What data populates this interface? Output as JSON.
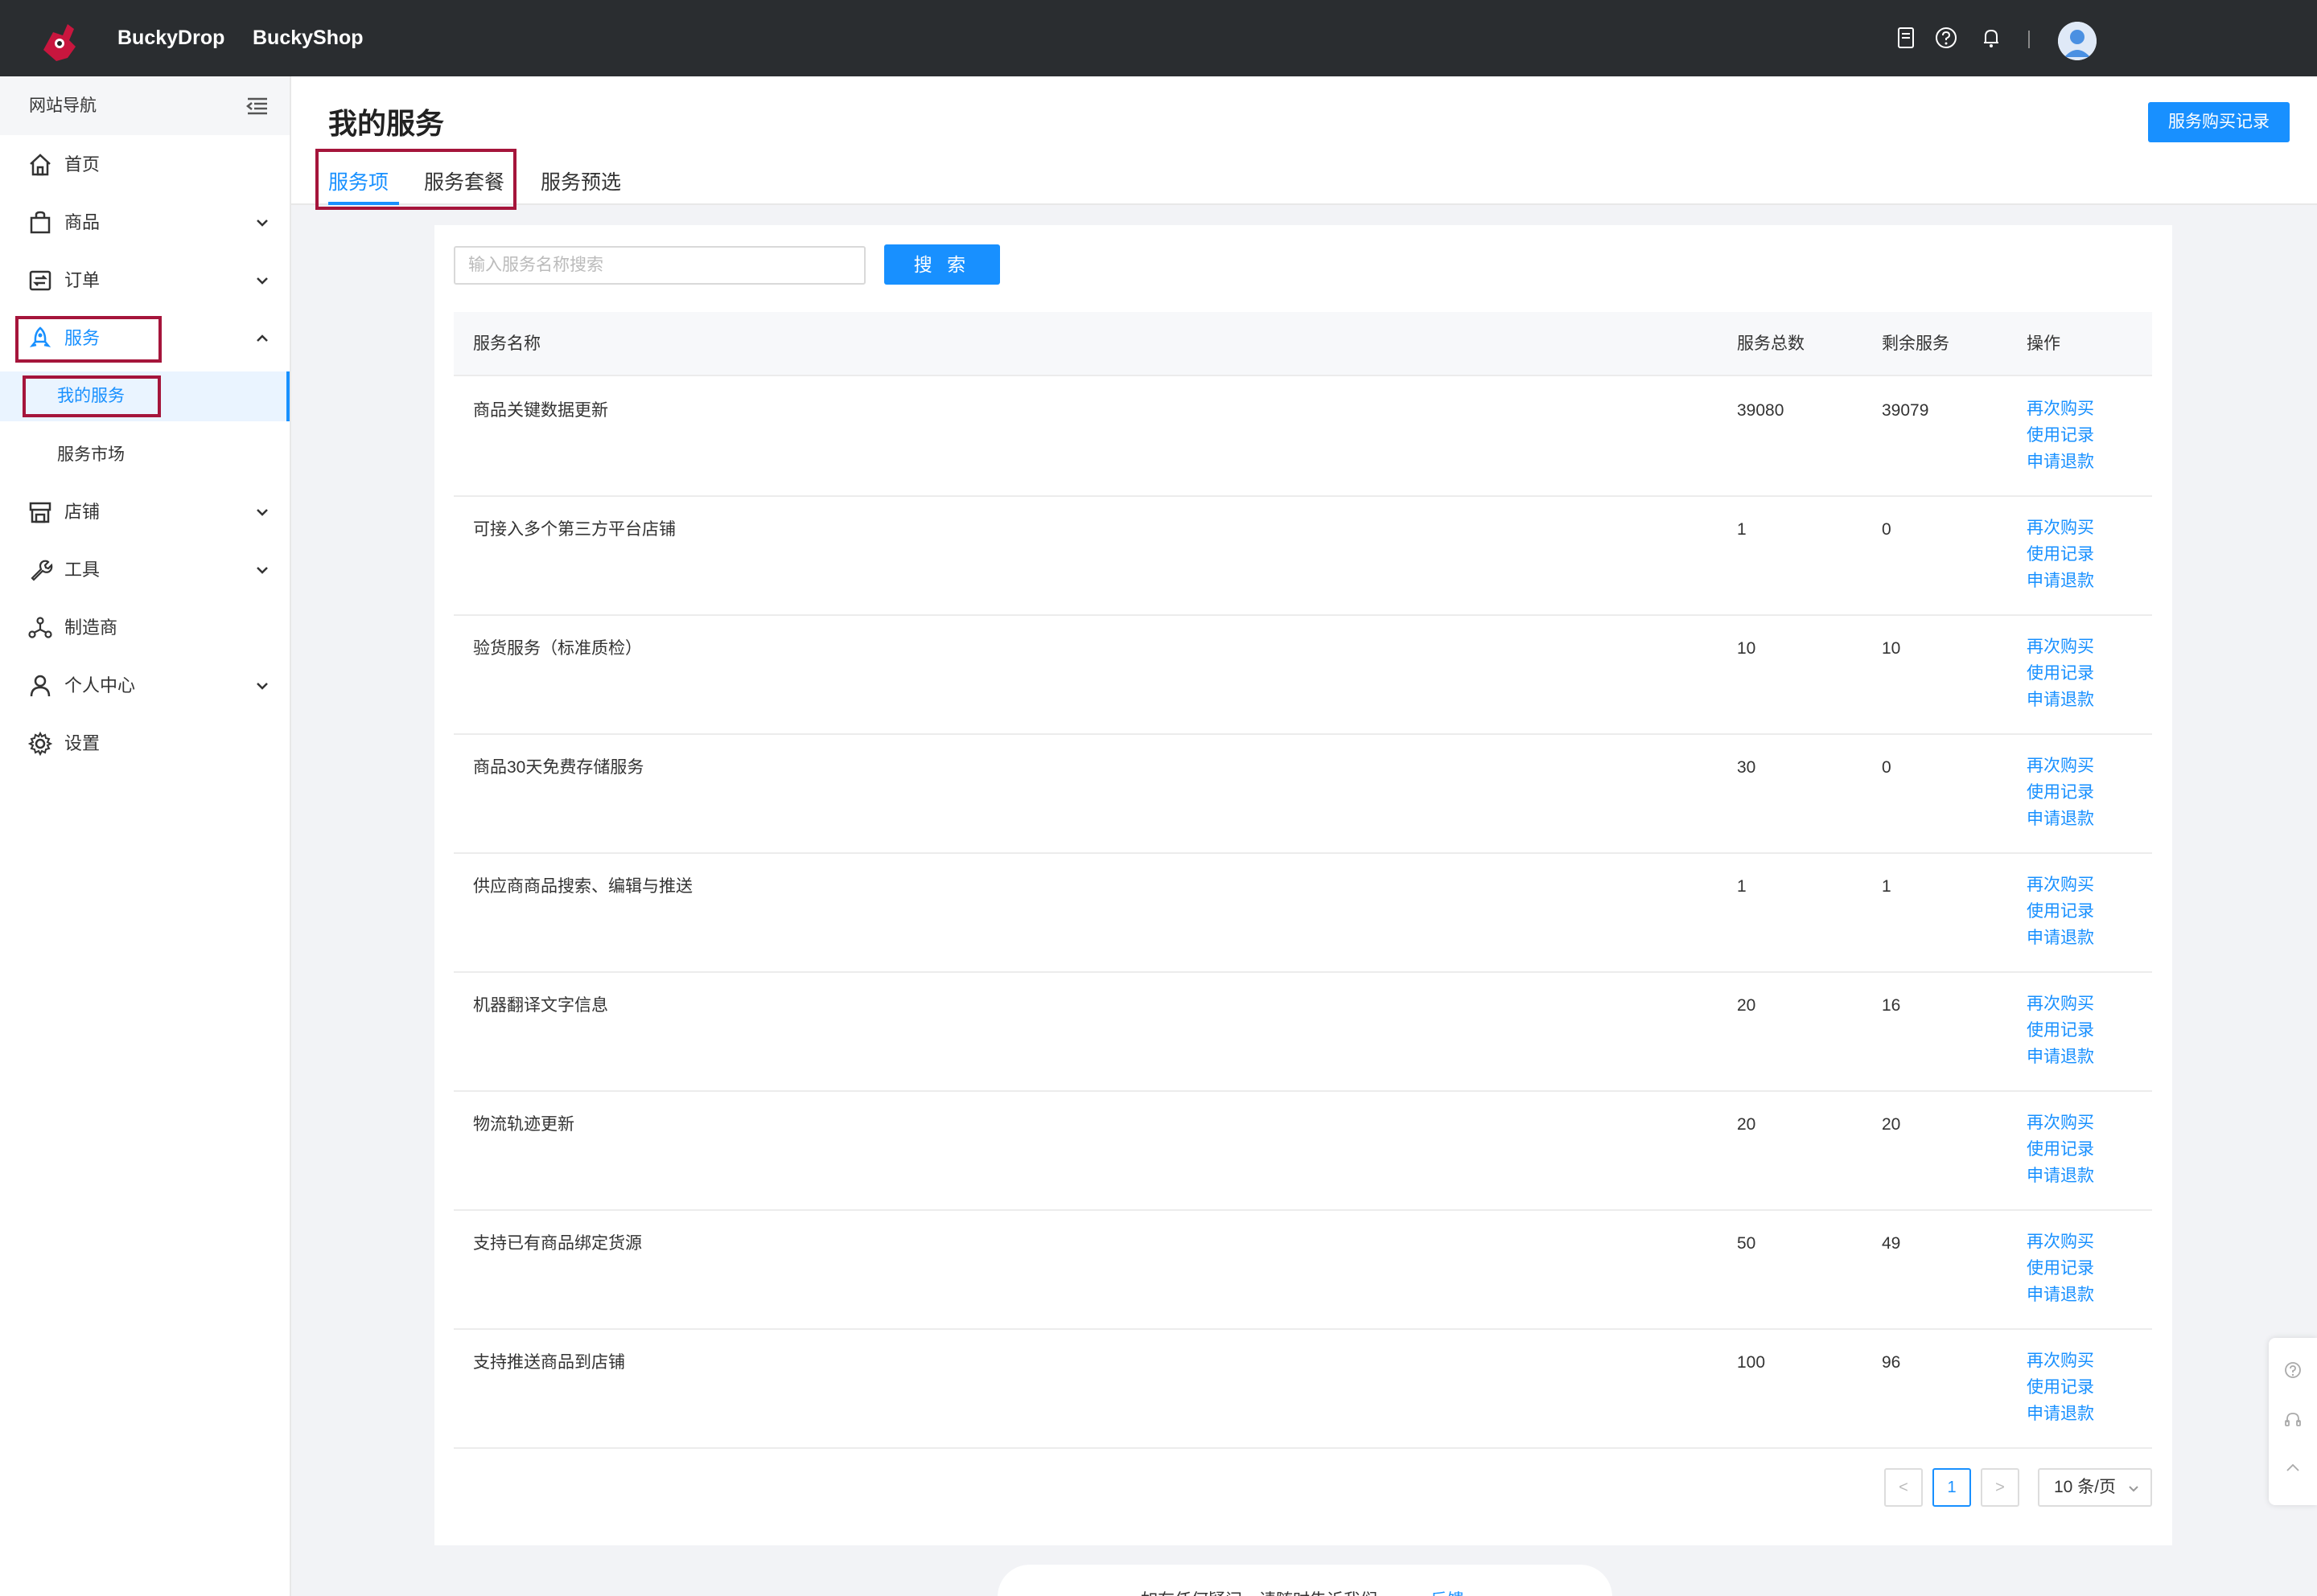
{
  "topbar": {
    "brand1": "BuckyDrop",
    "brand2": "BuckyShop"
  },
  "sidebar": {
    "header": "网站导航",
    "items": [
      {
        "label": "首页",
        "icon": "home-icon"
      },
      {
        "label": "商品",
        "icon": "bag-icon"
      },
      {
        "label": "订单",
        "icon": "order-icon"
      },
      {
        "label": "服务",
        "icon": "rocket-icon"
      },
      {
        "label": "我的服务"
      },
      {
        "label": "服务市场"
      },
      {
        "label": "店铺",
        "icon": "store-icon"
      },
      {
        "label": "工具",
        "icon": "wrench-icon"
      },
      {
        "label": "制造商",
        "icon": "network-icon"
      },
      {
        "label": "个人中心",
        "icon": "user-icon"
      },
      {
        "label": "设置",
        "icon": "gear-icon"
      }
    ]
  },
  "header": {
    "title": "我的服务",
    "buy_record_label": "服务购买记录",
    "tabs": [
      "服务项",
      "服务套餐",
      "服务预选"
    ]
  },
  "search": {
    "placeholder": "输入服务名称搜索",
    "button_label": "搜 索"
  },
  "table": {
    "columns": [
      "服务名称",
      "服务总数",
      "剩余服务",
      "操作"
    ],
    "rows": [
      {
        "name": "商品关键数据更新",
        "total": "39080",
        "remaining": "39079"
      },
      {
        "name": "可接入多个第三方平台店铺",
        "total": "1",
        "remaining": "0"
      },
      {
        "name": "验货服务（标准质检）",
        "total": "10",
        "remaining": "10"
      },
      {
        "name": "商品30天免费存储服务",
        "total": "30",
        "remaining": "0"
      },
      {
        "name": "供应商商品搜索、编辑与推送",
        "total": "1",
        "remaining": "1"
      },
      {
        "name": "机器翻译文字信息",
        "total": "20",
        "remaining": "16"
      },
      {
        "name": "物流轨迹更新",
        "total": "20",
        "remaining": "20"
      },
      {
        "name": "支持已有商品绑定货源",
        "total": "50",
        "remaining": "49"
      },
      {
        "name": "支持推送商品到店铺",
        "total": "100",
        "remaining": "96"
      }
    ],
    "actions": [
      "再次购买",
      "使用记录",
      "申请退款"
    ]
  },
  "pagination": {
    "prev": "<",
    "current": "1",
    "next": ">",
    "page_size": "10 条/页"
  },
  "footer": {
    "text": "如有任何疑问，请随时告诉我们",
    "link": "反馈"
  },
  "colors": {
    "accent": "#1890ff",
    "topbar": "#2a2d30",
    "highlight_box": "#a5153b"
  }
}
